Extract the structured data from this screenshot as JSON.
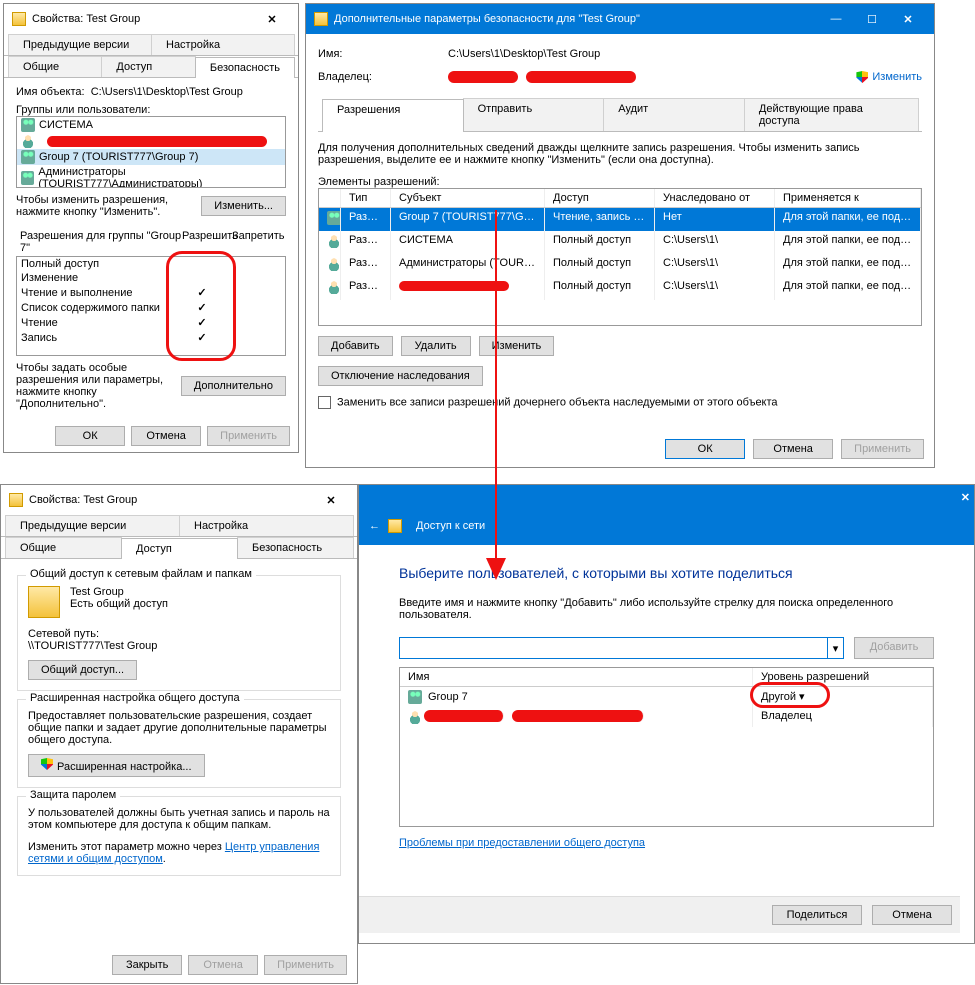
{
  "props": {
    "title": "Свойства: Test Group",
    "tabs": [
      "Предыдущие версии",
      "Настройка",
      "Общие",
      "Доступ",
      "Безопасность"
    ],
    "obj_label": "Имя объекта:",
    "obj_path": "C:\\Users\\1\\Desktop\\Test Group",
    "groups_label": "Группы или пользователи:",
    "groups": [
      "СИСТЕМА",
      "",
      "Group 7 (TOURIST777\\Group 7)",
      "Администраторы (TOURIST777\\Администраторы)"
    ],
    "change_hint": "Чтобы изменить разрешения, нажмите кнопку \"Изменить\".",
    "btn_change": "Изменить...",
    "perm_caption": "Разрешения для группы \"Group 7\"",
    "col_allow": "Разрешить",
    "col_deny": "Запретить",
    "perms": [
      {
        "name": "Полный доступ",
        "a": false
      },
      {
        "name": "Изменение",
        "a": false
      },
      {
        "name": "Чтение и выполнение",
        "a": true
      },
      {
        "name": "Список содержимого папки",
        "a": true
      },
      {
        "name": "Чтение",
        "a": true
      },
      {
        "name": "Запись",
        "a": true
      }
    ],
    "adv_hint": "Чтобы задать особые разрешения или параметры, нажмите кнопку \"Дополнительно\".",
    "btn_adv": "Дополнительно",
    "ok": "ОК",
    "cancel": "Отмена",
    "apply": "Применить"
  },
  "adv": {
    "title": "Дополнительные параметры безопасности для \"Test Group\"",
    "name_lbl": "Имя:",
    "name_val": "C:\\Users\\1\\Desktop\\Test Group",
    "owner_lbl": "Владелец:",
    "change": "Изменить",
    "tabs": [
      "Разрешения",
      "Отправить",
      "Аудит",
      "Действующие права доступа"
    ],
    "hint": "Для получения дополнительных сведений дважды щелкните запись разрешения. Чтобы изменить запись разрешения, выделите ее и нажмите кнопку \"Изменить\" (если она доступна).",
    "elem_lbl": "Элементы разрешений:",
    "cols": {
      "t": "Тип",
      "s": "Субъект",
      "d": "Доступ",
      "i": "Унаследовано от",
      "p": "Применяется к"
    },
    "rows": [
      {
        "t": "Разр...",
        "s": "Group 7 (TOURIST777\\Group 7)",
        "d": "Чтение, запись и вып...",
        "i": "Нет",
        "p": "Для этой папки, ее подпапок ..."
      },
      {
        "t": "Разр...",
        "s": "СИСТЕМА",
        "d": "Полный доступ",
        "i": "C:\\Users\\1\\",
        "p": "Для этой папки, ее подпапок ..."
      },
      {
        "t": "Разр...",
        "s": "Администраторы (TOURIST7...",
        "d": "Полный доступ",
        "i": "C:\\Users\\1\\",
        "p": "Для этой папки, ее подпапок ..."
      },
      {
        "t": "Разр...",
        "s": "",
        "d": "Полный доступ",
        "i": "C:\\Users\\1\\",
        "p": "Для этой папки, ее подпапок ..."
      }
    ],
    "add": "Добавить",
    "del": "Удалить",
    "chg": "Изменить",
    "inh": "Отключение наследования",
    "repl": "Заменить все записи разрешений дочернего объекта наследуемыми от этого объекта",
    "ok": "ОК",
    "cancel": "Отмена",
    "apply": "Применить"
  },
  "share_props": {
    "title": "Свойства: Test Group",
    "tabs": [
      "Предыдущие версии",
      "Настройка",
      "Общие",
      "Доступ",
      "Безопасность"
    ],
    "g1": {
      "label": "Общий доступ к сетевым файлам и папкам",
      "name": "Test Group",
      "status": "Есть общий доступ",
      "path_lbl": "Сетевой путь:",
      "path": "\\\\TOURIST777\\Test Group",
      "btn": "Общий доступ..."
    },
    "g2": {
      "label": "Расширенная настройка общего доступа",
      "desc": "Предоставляет пользовательские разрешения, создает общие папки и задает другие дополнительные параметры общего доступа.",
      "btn": "Расширенная настройка..."
    },
    "g3": {
      "label": "Защита паролем",
      "desc": "У пользователей должны быть учетная запись и пароль на этом компьютере для доступа к общим папкам.",
      "text2": "Изменить этот параметр можно через ",
      "link": "Центр управления сетями и общим доступом",
      "dot": "."
    },
    "close": "Закрыть",
    "cancel": "Отмена",
    "apply": "Применить"
  },
  "net": {
    "title": "Доступ к сети",
    "heading": "Выберите пользователей, с которыми вы хотите поделиться",
    "sub": "Введите имя и нажмите кнопку \"Добавить\" либо используйте стрелку для поиска определенного пользователя.",
    "add": "Добавить",
    "col_name": "Имя",
    "col_lvl": "Уровень разрешений",
    "rows": [
      {
        "name": "Group 7",
        "lvl": "Другой"
      },
      {
        "name": "",
        "lvl": "Владелец"
      }
    ],
    "trouble": "Проблемы при предоставлении общего доступа",
    "share": "Поделиться",
    "cancel": "Отмена"
  }
}
